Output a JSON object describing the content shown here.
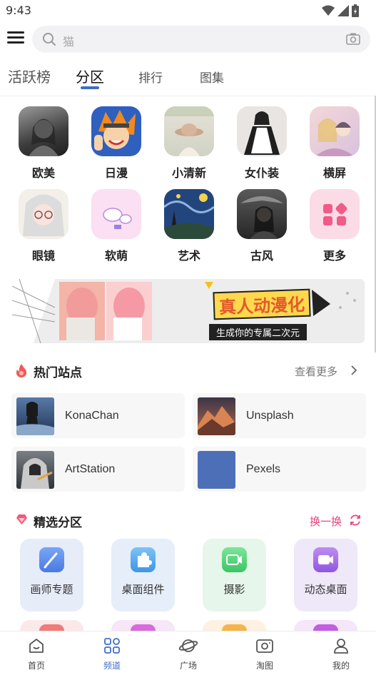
{
  "status_bar": {
    "time": "9:43"
  },
  "search": {
    "placeholder": "猫"
  },
  "tabs": [
    {
      "label": "活跃榜"
    },
    {
      "label": "分区"
    },
    {
      "label": "排行"
    },
    {
      "label": "图集"
    }
  ],
  "categories": [
    {
      "label": "欧美"
    },
    {
      "label": "日漫"
    },
    {
      "label": "小清新"
    },
    {
      "label": "女仆装"
    },
    {
      "label": "横屏"
    },
    {
      "label": "眼镜"
    },
    {
      "label": "软萌"
    },
    {
      "label": "艺术"
    },
    {
      "label": "古风"
    },
    {
      "label": "更多"
    }
  ],
  "banner": {
    "title": "真人动漫化",
    "subtitle": "生成你的专属二次元"
  },
  "hot_sites": {
    "title": "热门站点",
    "more": "查看更多",
    "items": [
      {
        "name": "KonaChan"
      },
      {
        "name": "Unsplash"
      },
      {
        "name": "ArtStation"
      },
      {
        "name": "Pexels"
      }
    ]
  },
  "featured": {
    "title": "精选分区",
    "refresh": "换一换",
    "items": [
      {
        "label": "画师专题",
        "icon": "brush-icon",
        "color": "#5b8def"
      },
      {
        "label": "桌面组件",
        "icon": "puzzle-icon",
        "color": "#5aa9ee"
      },
      {
        "label": "摄影",
        "icon": "video-camera-icon",
        "color": "#4fd17a"
      },
      {
        "label": "动态桌面",
        "icon": "video-icon",
        "color": "#a86ee6"
      }
    ]
  },
  "bottom_nav": [
    {
      "label": "首页",
      "icon": "home-icon"
    },
    {
      "label": "频道",
      "icon": "grid-icon"
    },
    {
      "label": "广场",
      "icon": "planet-icon"
    },
    {
      "label": "淘图",
      "icon": "photo-icon"
    },
    {
      "label": "我的",
      "icon": "user-icon"
    }
  ],
  "colors": {
    "accent": "#3f6ec4",
    "refresh": "#e8457d"
  }
}
